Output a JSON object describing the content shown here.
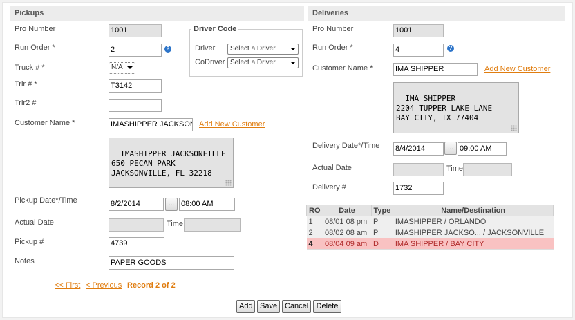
{
  "pickups": {
    "header": "Pickups",
    "pro_number_label": "Pro Number",
    "pro_number_value": "1001",
    "run_order_label": "Run Order *",
    "run_order_value": "2",
    "truck_label": "Truck # *",
    "truck_value": "N/A",
    "trlr_label": "Trlr # *",
    "trlr_value": "T3142",
    "trlr2_label": "Trlr2 #",
    "trlr2_value": "",
    "customer_label": "Customer Name *",
    "customer_value": "IMASHIPPER JACKSONV",
    "add_customer_link": "Add New Customer",
    "address": "IMASHIPPER JACKSONFILLE\n650 PECAN PARK\nJACKSONVILLE, FL 32218",
    "pickup_date_label": "Pickup Date*/Time",
    "pickup_date_value": "8/2/2014",
    "pickup_time_value": "08:00 AM",
    "actual_date_label": "Actual Date",
    "time_label": "Time",
    "pickup_num_label": "Pickup #",
    "pickup_num_value": "4739",
    "notes_label": "Notes",
    "notes_value": "PAPER GOODS"
  },
  "driver_code": {
    "legend": "Driver Code",
    "driver_label": "Driver",
    "driver_value": "Select a Driver",
    "codriver_label": "CoDriver",
    "codriver_value": "Select a Driver"
  },
  "deliveries": {
    "header": "Deliveries",
    "pro_number_label": "Pro Number",
    "pro_number_value": "1001",
    "run_order_label": "Run Order *",
    "run_order_value": "4",
    "customer_label": "Customer Name *",
    "customer_value": "IMA SHIPPER",
    "add_customer_link": "Add New Customer",
    "address": "IMA SHIPPER\n2204 TUPPER LAKE LANE\nBAY CITY, TX 77404",
    "delivery_date_label": "Delivery Date*/Time",
    "delivery_date_value": "8/4/2014",
    "delivery_time_value": "09:00 AM",
    "actual_date_label": "Actual Date",
    "time_label": "Time",
    "delivery_num_label": "Delivery #",
    "delivery_num_value": "1732"
  },
  "stops_table": {
    "headers": [
      "RO",
      "Date",
      "Type",
      "Name/Destination"
    ],
    "rows": [
      {
        "ro": "1",
        "date": "08/01 08 pm",
        "type": "P",
        "name": "IMASHIPPER / ORLANDO",
        "highlighted": false
      },
      {
        "ro": "2",
        "date": "08/02 08 am",
        "type": "P",
        "name": "IMASHIPPER JACKSO... / JACKSONVILLE",
        "highlighted": false
      },
      {
        "ro": "4",
        "date": "08/04 09 am",
        "type": "D",
        "name": "IMA SHIPPER / BAY CITY",
        "highlighted": true
      }
    ]
  },
  "pager": {
    "first": "<< First",
    "previous": "< Previous",
    "record": "Record 2 of 2"
  },
  "buttons": {
    "add": "Add",
    "save": "Save",
    "cancel": "Cancel",
    "delete": "Delete",
    "ellipsis": "..."
  },
  "icons": {
    "help": "help-icon",
    "dropdown": "chevron-down-icon"
  },
  "colors": {
    "link": "#e07d10",
    "highlight_row": "#f9c2c2",
    "help_icon": "#2c74c9"
  }
}
